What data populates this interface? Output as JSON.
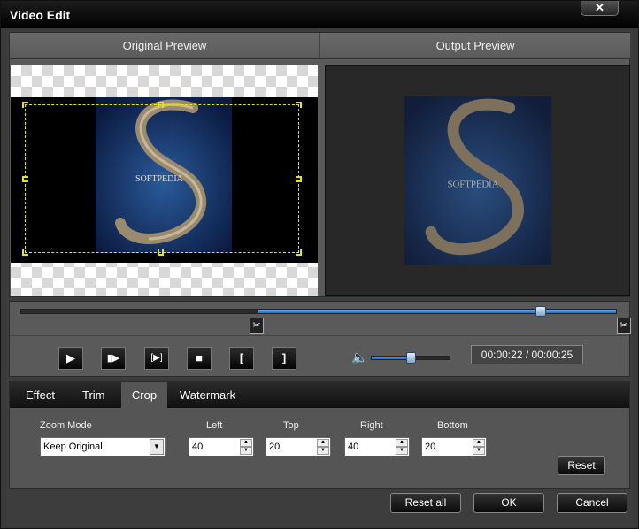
{
  "window": {
    "title": "Video Edit",
    "close_label": "✕"
  },
  "preview": {
    "original_label": "Original Preview",
    "output_label": "Output Preview",
    "watermark_text": "SOFTPEDIA"
  },
  "playback": {
    "time": "00:00:22 / 00:00:25",
    "progress": 0.88,
    "volume": 0.5,
    "controls": {
      "play": "▶",
      "step": "▮▶",
      "clip": "[▶]",
      "stop": "■",
      "mark_in": "[",
      "mark_out": "]"
    },
    "volume_icon": "🔈"
  },
  "tabs": [
    {
      "label": "Effect"
    },
    {
      "label": "Trim"
    },
    {
      "label": "Crop"
    },
    {
      "label": "Watermark"
    }
  ],
  "crop": {
    "zoom_mode_label": "Zoom Mode",
    "zoom_mode_value": "Keep Original",
    "left_label": "Left",
    "left_value": "40",
    "top_label": "Top",
    "top_value": "20",
    "right_label": "Right",
    "right_value": "40",
    "bottom_label": "Bottom",
    "bottom_value": "20",
    "reset_label": "Reset"
  },
  "footer": {
    "reset_all_label": "Reset all",
    "ok_label": "OK",
    "cancel_label": "Cancel"
  }
}
